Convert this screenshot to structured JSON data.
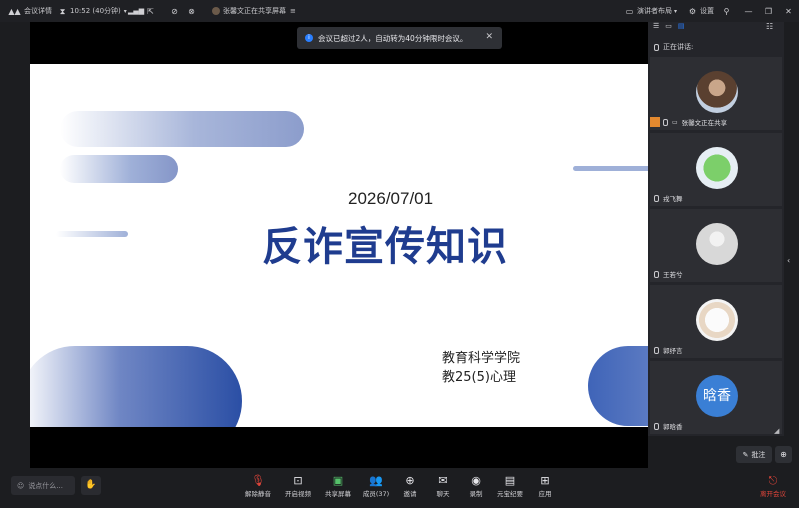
{
  "topbar": {
    "meeting_details": "会议详情",
    "timer": "10:52 (40分钟)",
    "sharing_status": "张馨文正在共享屏幕",
    "layout_label": "演讲者布局",
    "settings_label": "设置"
  },
  "toast": {
    "message": "会议已超过2人，自动转为40分钟限时会议。"
  },
  "slide": {
    "date": "2026/07/01",
    "title": "反诈宣传知识",
    "department": "教育科学学院",
    "class": "教25(5)心理"
  },
  "panel": {
    "speaking_label": "正在讲话:",
    "participants": [
      {
        "name": "张馨文正在共享"
      },
      {
        "name": "戎飞舞"
      },
      {
        "name": "王若兮"
      },
      {
        "name": "郭纾言"
      },
      {
        "name": "郭晗香",
        "avatar_text": "晗香"
      }
    ]
  },
  "annotate_label": "批注",
  "bottombar": {
    "chat_placeholder": "说点什么...",
    "buttons": {
      "unmute": "解除静音",
      "start_video": "开启视频",
      "share_screen": "共享屏幕",
      "members": "成员(37)",
      "invite": "邀请",
      "chat": "聊天",
      "record": "录制",
      "minutes": "元宝纪要",
      "apps": "应用",
      "leave": "离开会议"
    }
  },
  "colors": {
    "accent": "#2a7fff",
    "slide_blue": "#1f3c8f",
    "leave_red": "#e0453a"
  }
}
